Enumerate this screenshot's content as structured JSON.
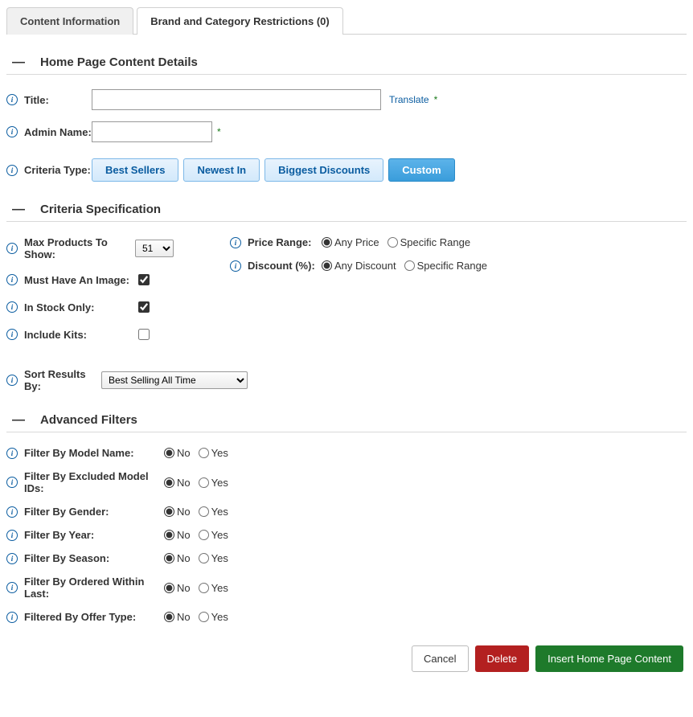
{
  "tabs": {
    "content_info": "Content Information",
    "brand_restrictions": "Brand and Category Restrictions (0)"
  },
  "sections": {
    "details": "Home Page Content Details",
    "criteria_spec": "Criteria Specification",
    "advanced": "Advanced Filters"
  },
  "details": {
    "title_label": "Title:",
    "title_value": "",
    "translate": "Translate",
    "admin_label": "Admin Name:",
    "admin_value": "",
    "criteria_type_label": "Criteria Type:",
    "criteria_options": {
      "best_sellers": "Best Sellers",
      "newest_in": "Newest In",
      "biggest_discounts": "Biggest Discounts",
      "custom": "Custom"
    }
  },
  "criteria": {
    "max_products_label": "Max Products To Show:",
    "max_products_value": "51",
    "must_have_image_label": "Must Have An Image:",
    "in_stock_label": "In Stock Only:",
    "include_kits_label": "Include Kits:",
    "sort_label": "Sort Results By:",
    "sort_value": "Best Selling All Time",
    "price_range_label": "Price Range:",
    "discount_label": "Discount (%):",
    "any_price": "Any Price",
    "specific_range": "Specific Range",
    "any_discount": "Any Discount"
  },
  "filters": {
    "model_name": "Filter By Model Name:",
    "excluded_ids": "Filter By Excluded Model IDs:",
    "gender": "Filter By Gender:",
    "year": "Filter By Year:",
    "season": "Filter By Season:",
    "ordered_within": "Filter By Ordered Within Last:",
    "offer_type": "Filtered By Offer Type:"
  },
  "radio": {
    "no": "No",
    "yes": "Yes"
  },
  "footer": {
    "cancel": "Cancel",
    "delete": "Delete",
    "insert": "Insert Home Page Content"
  }
}
